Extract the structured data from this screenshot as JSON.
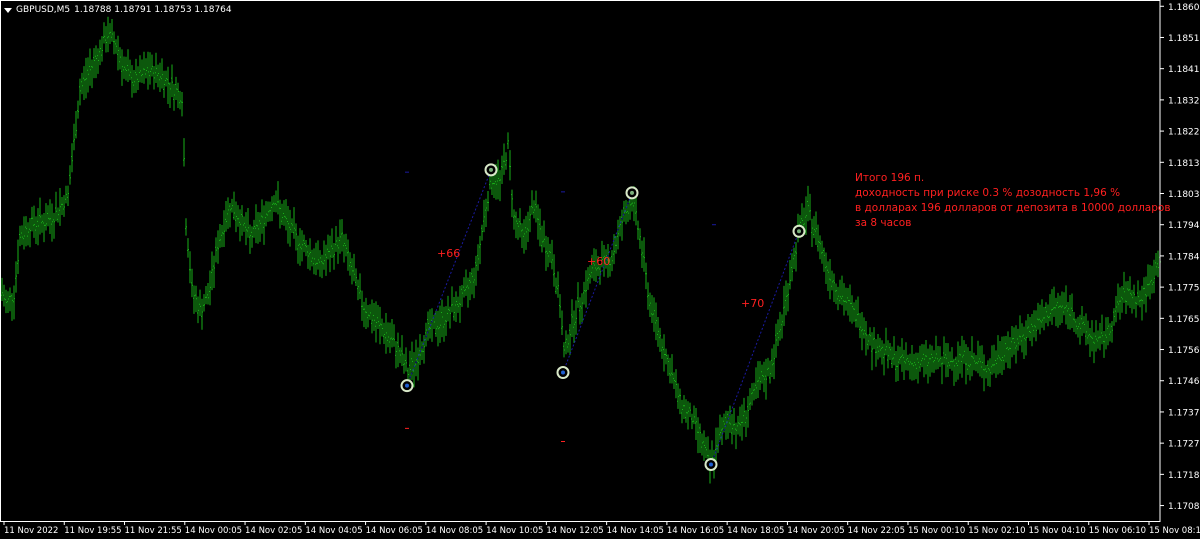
{
  "header": {
    "symbol": "GBPUSD,M5",
    "ohlc": "1.18788 1.18791 1.18753 1.18764"
  },
  "colors": {
    "background": "#000000",
    "candle": "#19b019",
    "frame": "#ffffff",
    "annotation": "#ff2020",
    "trend_line": "#1a1aa0",
    "marker_ring": "#d8e8c8",
    "marker_dot": "#1f5fd0"
  },
  "chart_data": {
    "type": "bar",
    "ylim": [
      1.17038,
      1.18618
    ],
    "y_ticks": [
      "1.18605",
      "1.18510",
      "1.18415",
      "1.18320",
      "1.18225",
      "1.18130",
      "1.18035",
      "1.17940",
      "1.17845",
      "1.17750",
      "1.17655",
      "1.17560",
      "1.17465",
      "1.17370",
      "1.17275",
      "1.17180",
      "1.17085"
    ],
    "x_ticks": [
      "11 Nov 2022",
      "11 Nov 19:55",
      "11 Nov 21:55",
      "14 Nov 00:05",
      "14 Nov 02:05",
      "14 Nov 04:05",
      "14 Nov 06:05",
      "14 Nov 08:05",
      "14 Nov 10:05",
      "14 Nov 12:05",
      "14 Nov 14:05",
      "14 Nov 16:05",
      "14 Nov 18:05",
      "14 Nov 20:05",
      "14 Nov 22:05",
      "15 Nov 00:10",
      "15 Nov 02:10",
      "15 Nov 04:10",
      "15 Nov 06:10",
      "15 Nov 08:10"
    ],
    "grid": false,
    "price_path": [
      [
        0,
        1.1775
      ],
      [
        6,
        1.177
      ],
      [
        14,
        1.1773
      ],
      [
        20,
        1.179
      ],
      [
        30,
        1.1794
      ],
      [
        45,
        1.1795
      ],
      [
        55,
        1.1797
      ],
      [
        68,
        1.1803
      ],
      [
        80,
        1.1835
      ],
      [
        90,
        1.1841
      ],
      [
        100,
        1.1847
      ],
      [
        108,
        1.1852
      ],
      [
        116,
        1.1849
      ],
      [
        126,
        1.184
      ],
      [
        136,
        1.1838
      ],
      [
        148,
        1.1841
      ],
      [
        160,
        1.184
      ],
      [
        172,
        1.1836
      ],
      [
        182,
        1.1833
      ],
      [
        186,
        1.1795
      ],
      [
        192,
        1.1774
      ],
      [
        200,
        1.1768
      ],
      [
        208,
        1.1772
      ],
      [
        218,
        1.1788
      ],
      [
        230,
        1.18
      ],
      [
        240,
        1.1796
      ],
      [
        250,
        1.179
      ],
      [
        262,
        1.1795
      ],
      [
        274,
        1.1802
      ],
      [
        284,
        1.1796
      ],
      [
        296,
        1.179
      ],
      [
        308,
        1.1786
      ],
      [
        320,
        1.1782
      ],
      [
        332,
        1.1786
      ],
      [
        342,
        1.179
      ],
      [
        352,
        1.178
      ],
      [
        362,
        1.177
      ],
      [
        374,
        1.1765
      ],
      [
        386,
        1.1761
      ],
      [
        398,
        1.1756
      ],
      [
        408,
        1.1749
      ],
      [
        418,
        1.1754
      ],
      [
        428,
        1.1762
      ],
      [
        440,
        1.1764
      ],
      [
        452,
        1.1768
      ],
      [
        464,
        1.1772
      ],
      [
        476,
        1.178
      ],
      [
        486,
        1.18
      ],
      [
        492,
        1.1808
      ],
      [
        500,
        1.1807
      ],
      [
        508,
        1.1818
      ],
      [
        514,
        1.1796
      ],
      [
        524,
        1.179
      ],
      [
        534,
        1.18
      ],
      [
        542,
        1.179
      ],
      [
        552,
        1.1784
      ],
      [
        560,
        1.177
      ],
      [
        564,
        1.1755
      ],
      [
        572,
        1.1764
      ],
      [
        582,
        1.1772
      ],
      [
        592,
        1.178
      ],
      [
        602,
        1.1782
      ],
      [
        612,
        1.1784
      ],
      [
        622,
        1.1795
      ],
      [
        632,
        1.1802
      ],
      [
        640,
        1.179
      ],
      [
        650,
        1.177
      ],
      [
        660,
        1.176
      ],
      [
        670,
        1.175
      ],
      [
        680,
        1.174
      ],
      [
        692,
        1.1735
      ],
      [
        702,
        1.1728
      ],
      [
        710,
        1.172
      ],
      [
        718,
        1.1728
      ],
      [
        728,
        1.1735
      ],
      [
        738,
        1.1732
      ],
      [
        748,
        1.1738
      ],
      [
        758,
        1.1745
      ],
      [
        770,
        1.175
      ],
      [
        780,
        1.1762
      ],
      [
        790,
        1.1778
      ],
      [
        800,
        1.1793
      ],
      [
        808,
        1.1798
      ],
      [
        818,
        1.179
      ],
      [
        828,
        1.178
      ],
      [
        840,
        1.1773
      ],
      [
        852,
        1.1768
      ],
      [
        862,
        1.1764
      ],
      [
        872,
        1.1758
      ],
      [
        882,
        1.1756
      ],
      [
        894,
        1.1753
      ],
      [
        906,
        1.1752
      ],
      [
        920,
        1.1752
      ],
      [
        934,
        1.1753
      ],
      [
        948,
        1.1752
      ],
      [
        962,
        1.1754
      ],
      [
        976,
        1.1752
      ],
      [
        990,
        1.175
      ],
      [
        1004,
        1.1756
      ],
      [
        1016,
        1.1758
      ],
      [
        1028,
        1.1762
      ],
      [
        1040,
        1.1764
      ],
      [
        1050,
        1.1768
      ],
      [
        1060,
        1.1769
      ],
      [
        1070,
        1.1768
      ],
      [
        1080,
        1.1763
      ],
      [
        1090,
        1.176
      ],
      [
        1100,
        1.1758
      ],
      [
        1110,
        1.1762
      ],
      [
        1120,
        1.1771
      ],
      [
        1130,
        1.1773
      ],
      [
        1140,
        1.1771
      ],
      [
        1150,
        1.1776
      ],
      [
        1160,
        1.1784
      ]
    ],
    "bar_x_range": [
      0,
      1160
    ],
    "trades": [
      {
        "label": "+66",
        "entry": [
          407,
          1.1745
        ],
        "exit": [
          491,
          1.18107
        ]
      },
      {
        "label": "+60",
        "entry": [
          563,
          1.1749
        ],
        "exit": [
          632,
          1.18037
        ]
      },
      {
        "label": "+70",
        "entry": [
          711,
          1.1721
        ],
        "exit": [
          799,
          1.1792
        ]
      }
    ],
    "aux_marks": [
      {
        "x": 407,
        "y": 1.181,
        "color": "#1a1aa0"
      },
      {
        "x": 563,
        "y": 1.1804,
        "color": "#1a1aa0"
      },
      {
        "x": 714,
        "y": 1.1794,
        "color": "#1a1aa0"
      },
      {
        "x": 407,
        "y": 1.1732,
        "color": "#ff2020"
      },
      {
        "x": 563,
        "y": 1.1728,
        "color": "#ff2020"
      }
    ]
  },
  "annotations": {
    "trade_labels": [
      "+66",
      "+60",
      "+70"
    ],
    "summary": [
      "Итого 196 п.",
      "доходность  при риске 0.3 % дозодность 1,96 %",
      "в долларах 196 долларов от депозита в 10000 долларов",
      "за 8 часов"
    ]
  }
}
